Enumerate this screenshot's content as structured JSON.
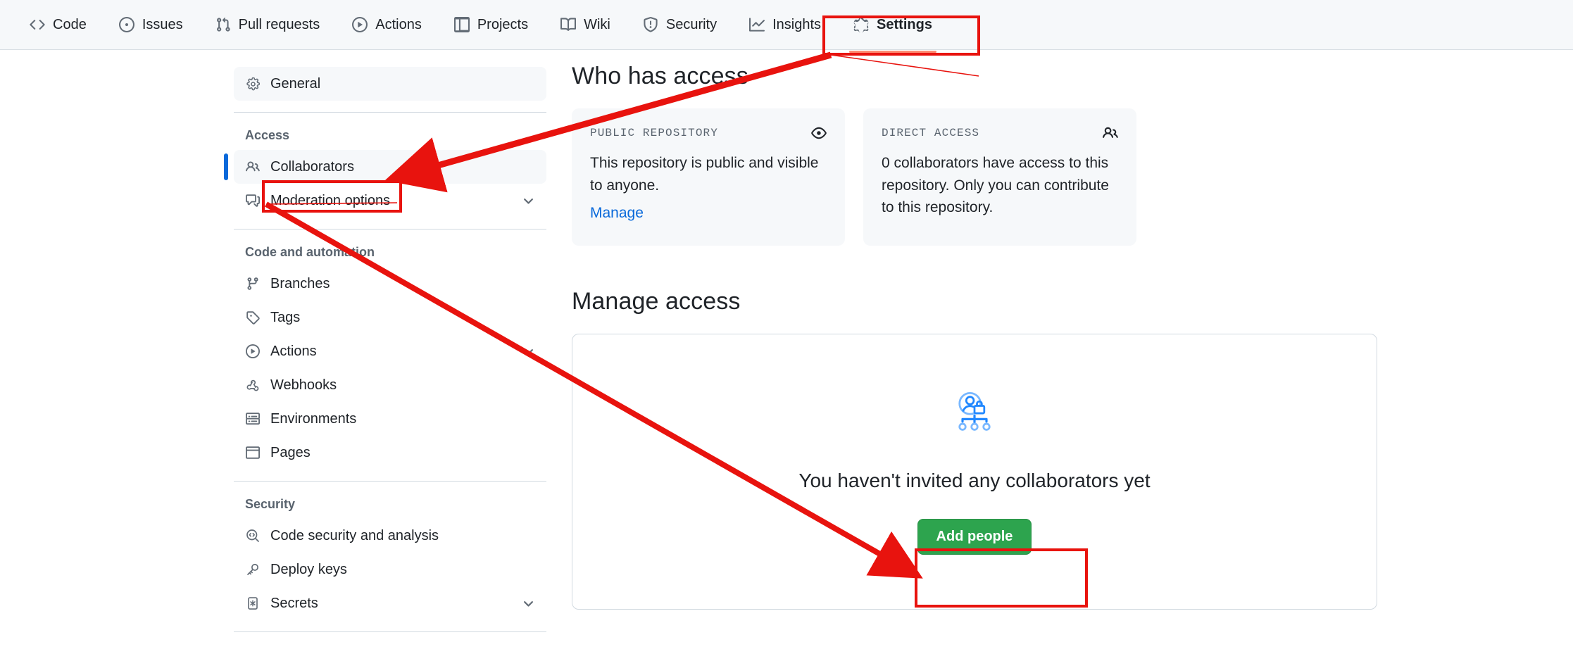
{
  "repo_nav": {
    "items": [
      {
        "label": "Code",
        "icon": "code-icon",
        "active": false
      },
      {
        "label": "Issues",
        "icon": "issue-opened-icon",
        "active": false
      },
      {
        "label": "Pull requests",
        "icon": "git-pull-request-icon",
        "active": false
      },
      {
        "label": "Actions",
        "icon": "play-icon",
        "active": false
      },
      {
        "label": "Projects",
        "icon": "table-icon",
        "active": false
      },
      {
        "label": "Wiki",
        "icon": "book-icon",
        "active": false
      },
      {
        "label": "Security",
        "icon": "shield-icon",
        "active": false
      },
      {
        "label": "Insights",
        "icon": "graph-icon",
        "active": false
      },
      {
        "label": "Settings",
        "icon": "gear-icon",
        "active": true
      }
    ]
  },
  "sidebar": {
    "top_items": [
      {
        "label": "General",
        "icon": "gear-icon",
        "selected": true,
        "chevron": false
      }
    ],
    "groups": [
      {
        "title": "Access",
        "items": [
          {
            "label": "Collaborators",
            "icon": "people-icon",
            "current": true,
            "chevron": false
          },
          {
            "label": "Moderation options",
            "icon": "comment-discussion-icon",
            "current": false,
            "chevron": true
          }
        ]
      },
      {
        "title": "Code and automation",
        "items": [
          {
            "label": "Branches",
            "icon": "git-branch-icon",
            "current": false,
            "chevron": false
          },
          {
            "label": "Tags",
            "icon": "tag-icon",
            "current": false,
            "chevron": false
          },
          {
            "label": "Actions",
            "icon": "play-icon",
            "current": false,
            "chevron": true
          },
          {
            "label": "Webhooks",
            "icon": "webhook-icon",
            "current": false,
            "chevron": false
          },
          {
            "label": "Environments",
            "icon": "server-icon",
            "current": false,
            "chevron": false
          },
          {
            "label": "Pages",
            "icon": "browser-icon",
            "current": false,
            "chevron": false
          }
        ]
      },
      {
        "title": "Security",
        "items": [
          {
            "label": "Code security and analysis",
            "icon": "codescan-icon",
            "current": false,
            "chevron": false
          },
          {
            "label": "Deploy keys",
            "icon": "key-icon",
            "current": false,
            "chevron": false
          },
          {
            "label": "Secrets",
            "icon": "asterisk-key-icon",
            "current": false,
            "chevron": true
          }
        ]
      }
    ]
  },
  "main": {
    "who_has_access_title": "Who has access",
    "cards": [
      {
        "label": "PUBLIC REPOSITORY",
        "icon": "eye-icon",
        "body": "This repository is public and visible to anyone.",
        "link": "Manage"
      },
      {
        "label": "DIRECT ACCESS",
        "icon": "people-icon",
        "count": "0",
        "body": "0 collaborators have access to this repository. Only you can contribute to this repository.",
        "link": ""
      }
    ],
    "manage_access_title": "Manage access",
    "empty_state": {
      "illustration": "locked-user-hierarchy-illustration",
      "title": "You haven't invited any collaborators yet",
      "button": "Add people"
    }
  },
  "colors": {
    "accent_blue": "#0969da",
    "button_green": "#2da44e",
    "annotation_red": "#e8130e",
    "active_tab_underline": "#fd8c73",
    "nav_background": "#f6f8fa"
  },
  "annotations": {
    "boxes": [
      {
        "name": "settings-tab-highlight"
      },
      {
        "name": "collaborators-link-highlight"
      },
      {
        "name": "add-people-button-highlight"
      }
    ],
    "arrows": [
      {
        "name": "arrow-settings-to-collaborators"
      },
      {
        "name": "arrow-collaborators-to-add-people"
      }
    ]
  }
}
